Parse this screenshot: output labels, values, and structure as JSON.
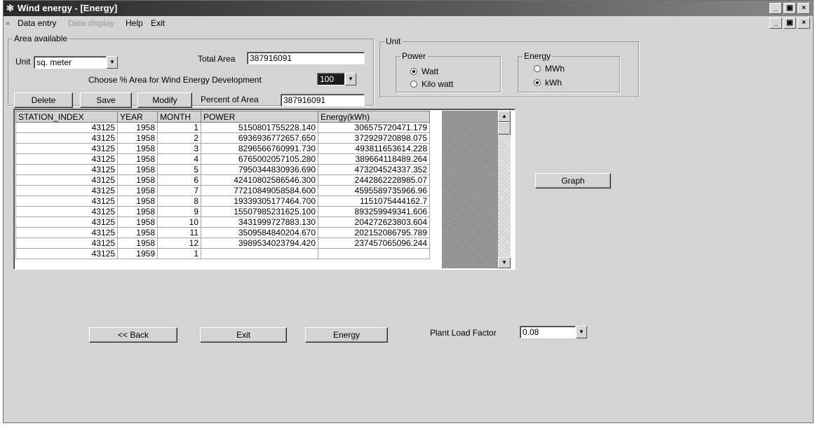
{
  "window": {
    "title": "Wind energy - [Energy]",
    "controls": [
      "_",
      "▣",
      "×"
    ]
  },
  "menu": {
    "items": [
      {
        "label": "Data entry",
        "enabled": true
      },
      {
        "label": "Data display",
        "enabled": false
      },
      {
        "label": "Help",
        "enabled": true
      },
      {
        "label": "Exit",
        "enabled": true
      }
    ]
  },
  "area": {
    "caption": "Area available",
    "unit_label": "Unit",
    "unit_value": "sq. meter",
    "total_area_label": "Total Area",
    "total_area_value": "387916091",
    "choose_label": "Choose % Area for Wind Energy Development",
    "choose_value": "100",
    "percent_label": "Percent of Area",
    "percent_value": "387916091"
  },
  "buttons": {
    "delete": "Delete",
    "save": "Save",
    "modify": "Modify",
    "graph": "Graph",
    "back": "<< Back",
    "exit": "Exit",
    "energy": "Energy"
  },
  "unit": {
    "caption": "Unit",
    "power_caption": "Power",
    "power_options": [
      {
        "label": "Watt",
        "selected": true
      },
      {
        "label": "Kilo watt",
        "selected": false
      }
    ],
    "energy_caption": "Energy",
    "energy_options": [
      {
        "label": "MWh",
        "selected": false
      },
      {
        "label": "kWh",
        "selected": true
      }
    ]
  },
  "grid": {
    "columns": [
      "STATION_INDEX",
      "YEAR",
      "MONTH",
      "POWER",
      "Energy(kWh)"
    ],
    "rows": [
      [
        "43125",
        "1958",
        "1",
        "5150801755228.140",
        "306575720471.179"
      ],
      [
        "43125",
        "1958",
        "2",
        "6936936772657.650",
        "372929720898.075"
      ],
      [
        "43125",
        "1958",
        "3",
        "8296566760991.730",
        "493811653614.228"
      ],
      [
        "43125",
        "1958",
        "4",
        "6765002057105.280",
        "389664118489.264"
      ],
      [
        "43125",
        "1958",
        "5",
        "7950344830936.690",
        "473204524337.352"
      ],
      [
        "43125",
        "1958",
        "6",
        "42410802586546.300",
        "2442862228985.07"
      ],
      [
        "43125",
        "1958",
        "7",
        "77210849058584.600",
        "4595589735966.96"
      ],
      [
        "43125",
        "1958",
        "8",
        "19339305177464.700",
        "1151075444162.7"
      ],
      [
        "43125",
        "1958",
        "9",
        "15507985231625.100",
        "893259949341.606"
      ],
      [
        "43125",
        "1958",
        "10",
        "3431999727883.130",
        "204272623803.604"
      ],
      [
        "43125",
        "1958",
        "11",
        "3509584840204.670",
        "202152086795.789"
      ],
      [
        "43125",
        "1958",
        "12",
        "3989534023794.420",
        "237457065096.244"
      ],
      [
        "43125",
        "1959",
        "1",
        "",
        ""
      ]
    ]
  },
  "plf": {
    "label": "Plant Load Factor",
    "value": "0.08"
  }
}
